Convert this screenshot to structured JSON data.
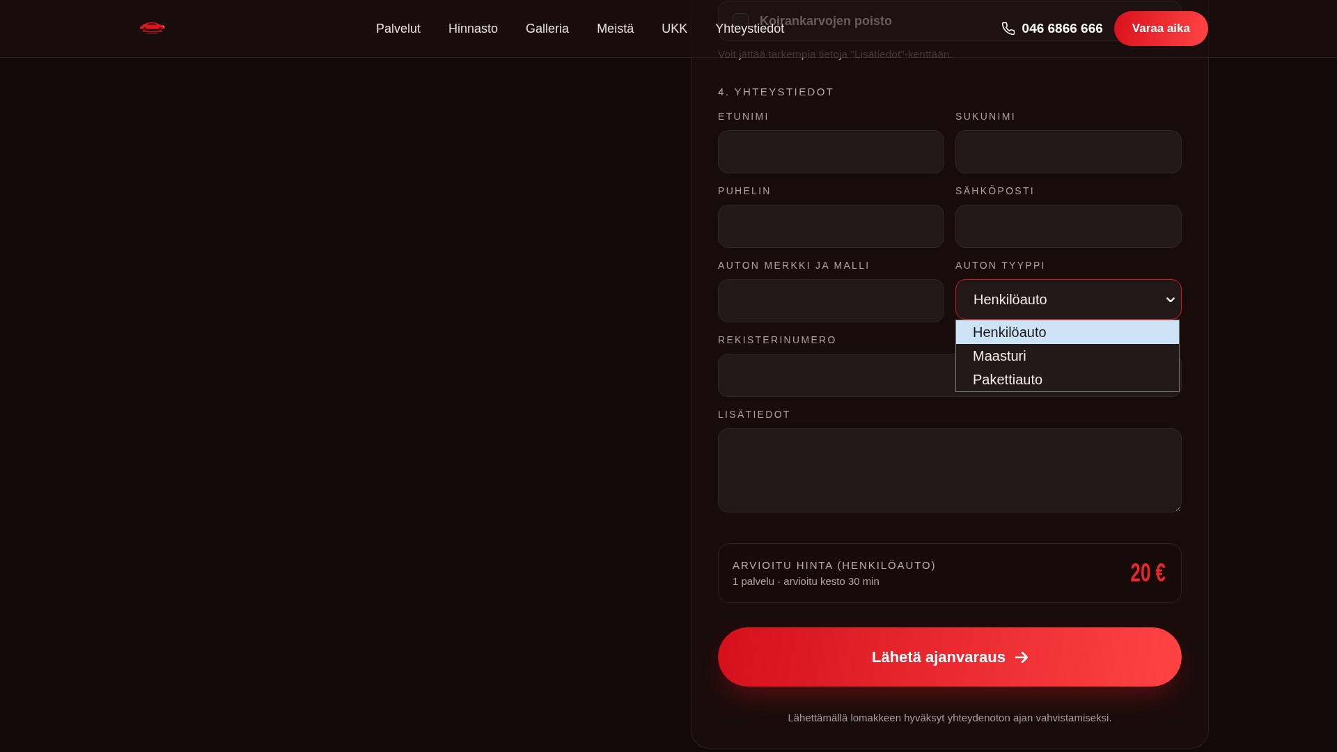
{
  "header": {
    "nav": [
      "Palvelut",
      "Hinnasto",
      "Galleria",
      "Meistä",
      "UKK",
      "Yhteystiedot"
    ],
    "phone": "046 6866 666",
    "cta": "Varaa aika"
  },
  "form": {
    "service_options": [
      {
        "label": "Koirankarvojen poisto",
        "checked": false
      }
    ],
    "hint": "Voit jättää tarkempia tietoja \"Lisätiedot\"-kenttään.",
    "section_title": "4. YHTEYSTIEDOT",
    "field_rows": [
      [
        {
          "kind": "input",
          "label": "ETUNIMI"
        },
        {
          "kind": "input",
          "label": "SUKUNIMI"
        }
      ],
      [
        {
          "kind": "input",
          "label": "PUHELIN"
        },
        {
          "kind": "input",
          "label": "SÄHKÖPOSTI"
        }
      ],
      [
        {
          "kind": "input",
          "label": "AUTON MERKKI JA MALLI"
        },
        {
          "kind": "select",
          "label": "AUTON TYYPPI",
          "value": "Henkilöauto",
          "open": true,
          "options": [
            {
              "label": "Henkilöauto",
              "selected": true
            },
            {
              "label": "Maasturi",
              "selected": false
            },
            {
              "label": "Pakettiauto",
              "selected": false
            }
          ]
        }
      ],
      [
        {
          "kind": "input",
          "label": "REKISTERINUMERO"
        }
      ],
      [
        {
          "kind": "textarea",
          "label": "LISÄTIEDOT"
        }
      ]
    ],
    "price": {
      "title": "ARVIOITU HINTA (HENKILÖAUTO)",
      "details": "1 palvelu · arvioitu kesto 30 min",
      "amount": "20 €"
    },
    "submit": "Lähetä ajanvaraus",
    "footnote": "Lähettämällä lomakkeen hyväksyt yhteydenoton ajan vahvistamiseksi."
  }
}
